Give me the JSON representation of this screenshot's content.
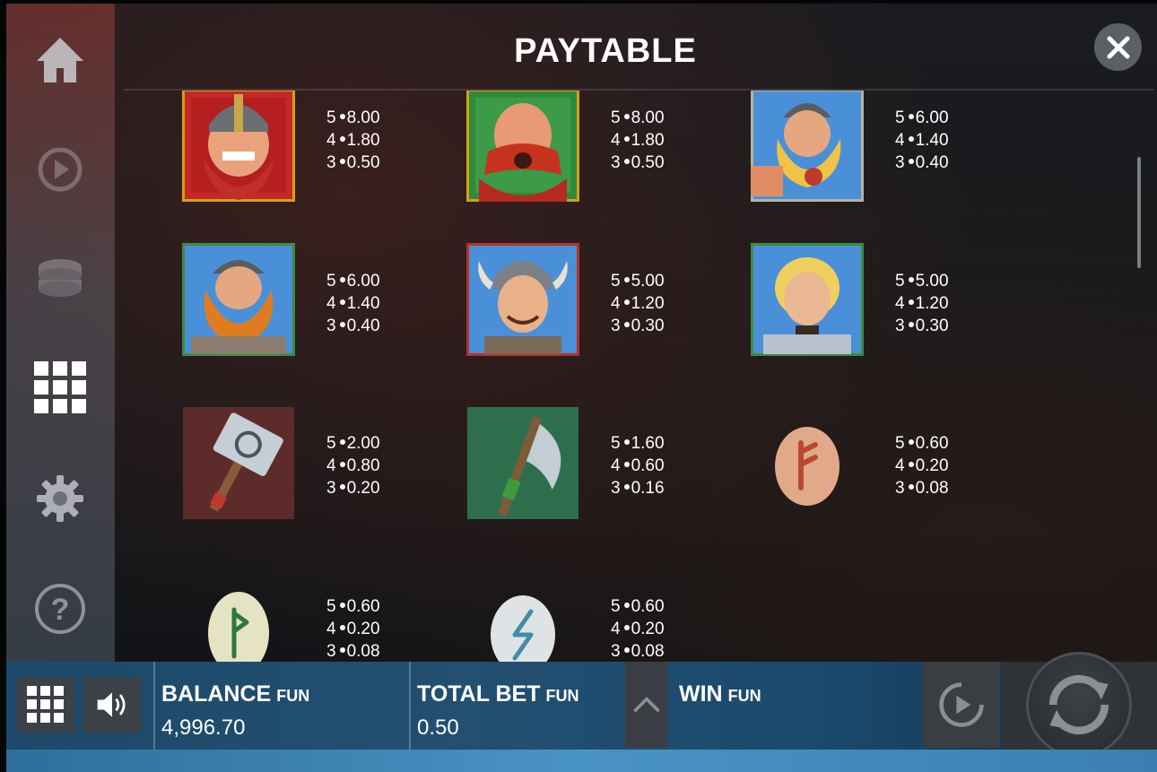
{
  "header": {
    "title": "PAYTABLE"
  },
  "sidebar": {
    "items": [
      {
        "icon": "home-icon"
      },
      {
        "icon": "autoplay-icon"
      },
      {
        "icon": "coins-icon"
      },
      {
        "icon": "paytable-grid-icon"
      },
      {
        "icon": "settings-gear-icon"
      },
      {
        "icon": "help-icon"
      }
    ]
  },
  "symbols": [
    {
      "name": "red-beard-viking",
      "pays": [
        "5",
        "8.00",
        "4",
        "1.80",
        "3",
        "0.50"
      ]
    },
    {
      "name": "red-moustache-viking",
      "pays": [
        "5",
        "8.00",
        "4",
        "1.80",
        "3",
        "0.50"
      ]
    },
    {
      "name": "blonde-beard-viking",
      "pays": [
        "5",
        "6.00",
        "4",
        "1.40",
        "3",
        "0.40"
      ]
    },
    {
      "name": "ginger-beard-viking",
      "pays": [
        "5",
        "6.00",
        "4",
        "1.40",
        "3",
        "0.40"
      ]
    },
    {
      "name": "young-viking",
      "pays": [
        "5",
        "5.00",
        "4",
        "1.20",
        "3",
        "0.30"
      ]
    },
    {
      "name": "shieldmaiden",
      "pays": [
        "5",
        "5.00",
        "4",
        "1.20",
        "3",
        "0.30"
      ]
    },
    {
      "name": "hammer",
      "pays": [
        "5",
        "2.00",
        "4",
        "0.80",
        "3",
        "0.20"
      ]
    },
    {
      "name": "axe",
      "pays": [
        "5",
        "1.60",
        "4",
        "0.60",
        "3",
        "0.16"
      ]
    },
    {
      "name": "red-rune-stone",
      "pays": [
        "5",
        "0.60",
        "4",
        "0.20",
        "3",
        "0.08"
      ]
    },
    {
      "name": "green-rune-stone",
      "pays": [
        "5",
        "0.60",
        "4",
        "0.20",
        "3",
        "0.08"
      ]
    },
    {
      "name": "blue-rune-stone",
      "pays": [
        "5",
        "0.60",
        "4",
        "0.20",
        "3",
        "0.08"
      ]
    }
  ],
  "bottom_bar": {
    "balance_label": "BALANCE",
    "balance_unit": "FUN",
    "balance_value": "4,996.70",
    "total_bet_label": "TOTAL BET",
    "total_bet_unit": "FUN",
    "total_bet_value": "0.50",
    "win_label": "WIN",
    "win_unit": "FUN"
  },
  "colors": {
    "accent_red": "#c0392b",
    "accent_green": "#3a8a3a",
    "bar_blue": "#234f70"
  }
}
